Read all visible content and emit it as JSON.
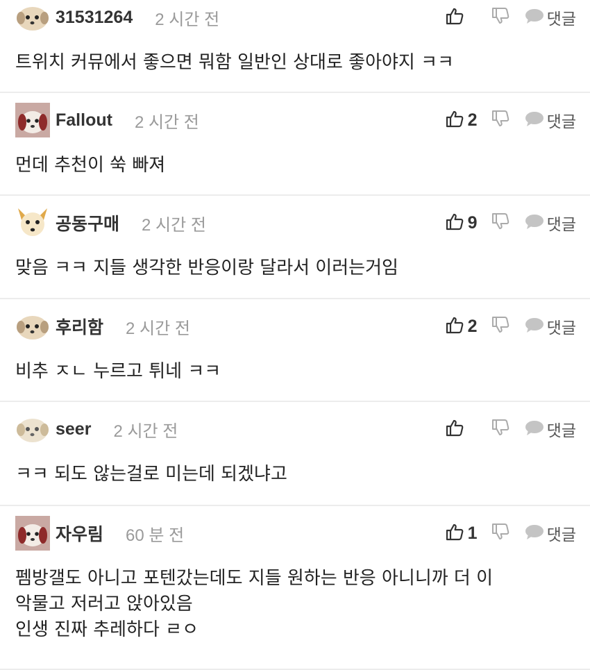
{
  "reply_label": "댓글",
  "comments": [
    {
      "author": "31531264",
      "time": "2 시간 전",
      "likes": "",
      "lines": [
        "트위치 커뮤에서 좋으면 뭐함 일반인 상대로 좋아야지 ㅋㅋ"
      ]
    },
    {
      "author": "Fallout",
      "time": "2 시간 전",
      "likes": "2",
      "lines": [
        "먼데 추천이 쑥 빠져"
      ]
    },
    {
      "author": "공동구매",
      "time": "2 시간 전",
      "likes": "9",
      "lines": [
        "맞음 ㅋㅋ 지들 생각한 반응이랑 달라서 이러는거임"
      ]
    },
    {
      "author": "후리함",
      "time": "2 시간 전",
      "likes": "2",
      "lines": [
        "비추 ㅈㄴ 누르고 튀네 ㅋㅋ"
      ]
    },
    {
      "author": "seer",
      "time": "2 시간 전",
      "likes": "",
      "lines": [
        "ㅋㅋ 되도 않는걸로 미는데 되겠냐고"
      ]
    },
    {
      "author": "자우림",
      "time": "60 분 전",
      "likes": "1",
      "lines": [
        "펨방갤도 아니고 포텐갔는데도 지들 원하는 반응 아니니까 더 이",
        "악물고 저러고 앉아있음",
        "인생 진짜 추레하다 ㄹㅇ"
      ]
    }
  ]
}
